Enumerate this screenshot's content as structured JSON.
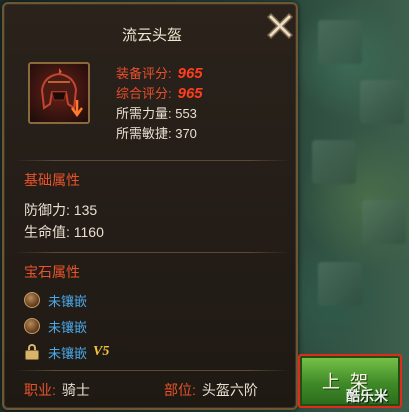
{
  "item": {
    "name": "流云头盔",
    "equip_score_label": "装备评分:",
    "equip_score_value": "965",
    "overall_score_label": "综合评分:",
    "overall_score_value": "965",
    "req_strength": "所需力量: 553",
    "req_agility": "所需敏捷: 370"
  },
  "basic_attributes": {
    "title": "基础属性",
    "defense": "防御力: 135",
    "hp": "生命值: 1160"
  },
  "gem_attributes": {
    "title": "宝石属性",
    "slots": [
      {
        "text": "未镶嵌",
        "locked": false
      },
      {
        "text": "未镶嵌",
        "locked": false
      },
      {
        "text": "未镶嵌",
        "locked": true,
        "requirement": "V5"
      }
    ]
  },
  "footer": {
    "class_label": "职业:",
    "class_value": "骑士",
    "slot_label": "部位:",
    "slot_value": "头盔六阶"
  },
  "actions": {
    "shelve_label": "上架"
  },
  "watermark": "酷乐米",
  "colors": {
    "accent_red": "#e9532b",
    "score_red": "#ff3d1f",
    "gem_blue": "#4aa8e8",
    "vip_gold": "#f3c542",
    "button_green": "#3f8a28",
    "button_border": "#e2291c"
  },
  "icons": {
    "close": "close-x-icon",
    "item": "helmet-icon",
    "downgrade": "down-arrow-icon",
    "gem_empty": "gem-slot-icon",
    "gem_locked": "lock-icon"
  }
}
